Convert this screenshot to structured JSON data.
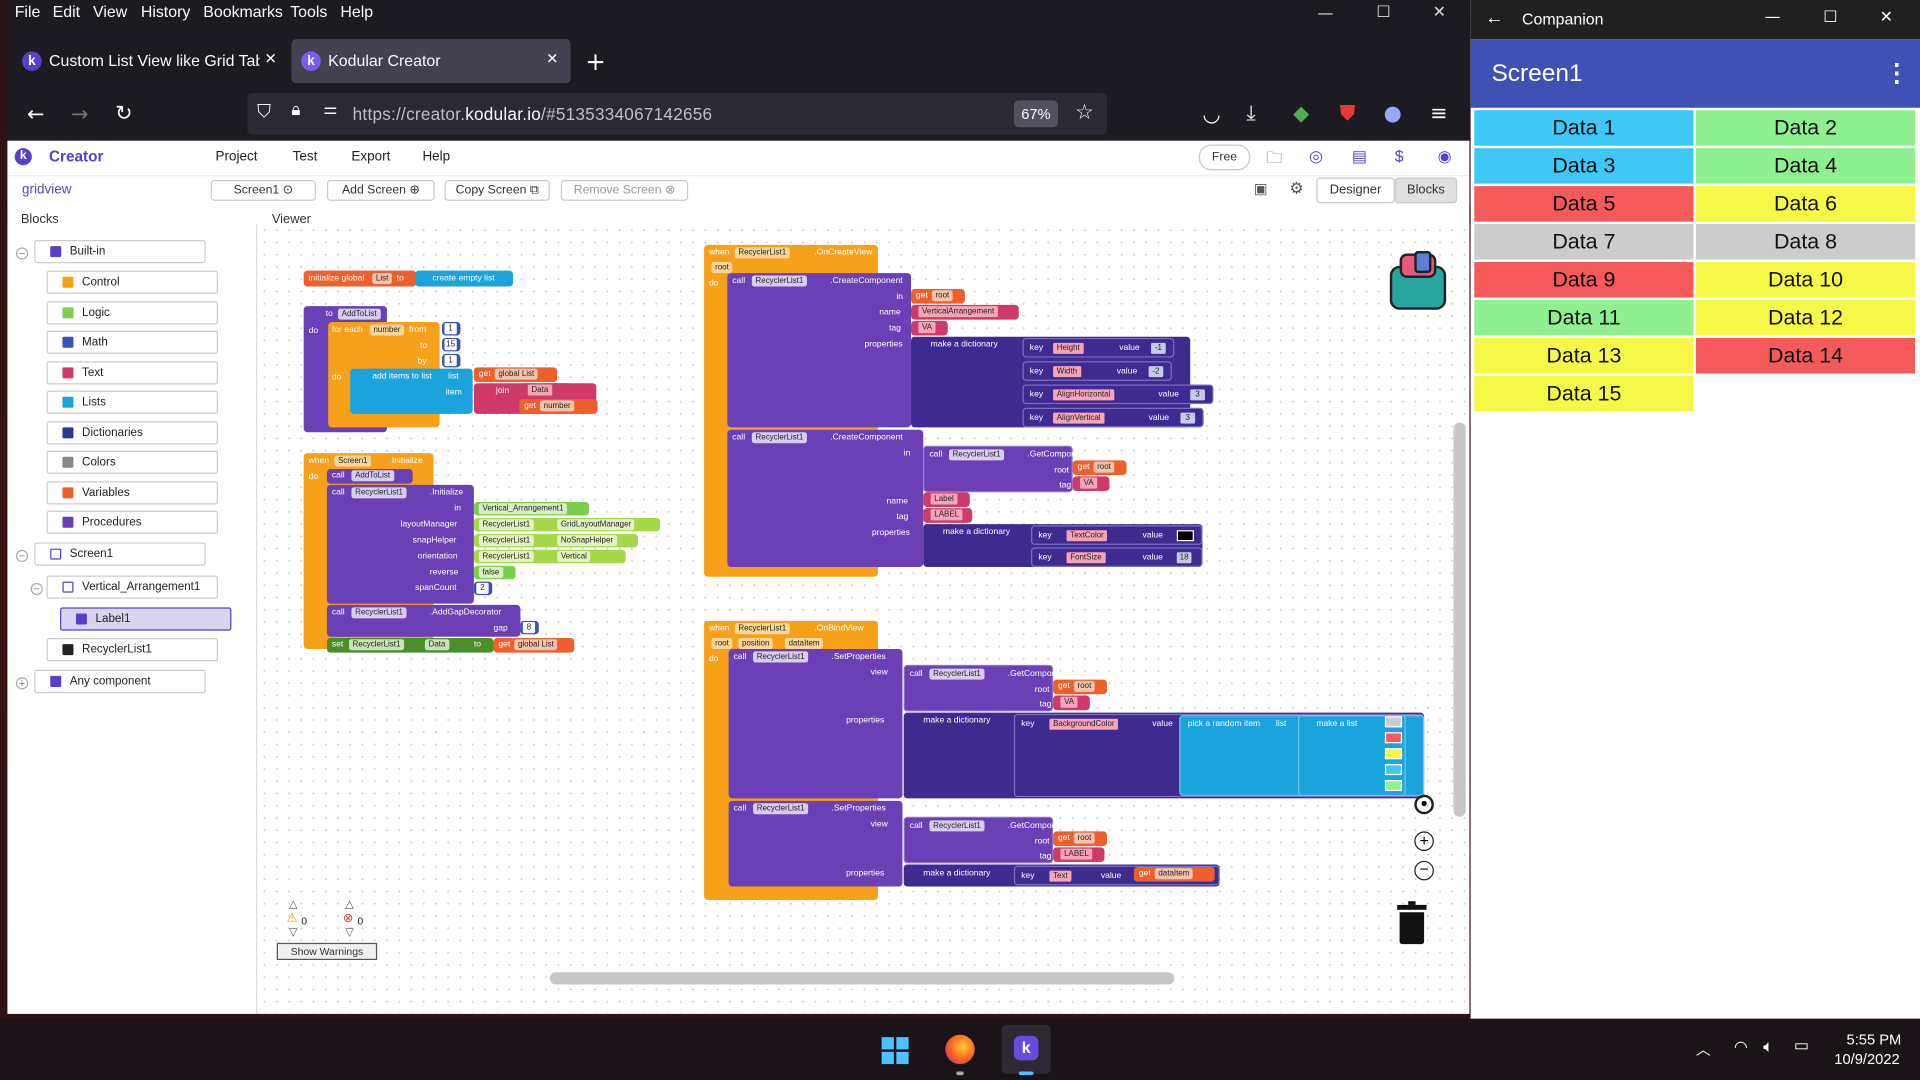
{
  "menubar": {
    "file": "File",
    "edit": "Edit",
    "view": "View",
    "history": "History",
    "bookmarks": "Bookmarks",
    "tools": "Tools",
    "help": "Help"
  },
  "tabs": [
    {
      "label": "Custom List View like Grid Table"
    },
    {
      "label": "Kodular Creator"
    }
  ],
  "url": {
    "prefix": "https://creator.",
    "domain": "kodular.io",
    "suffix": "/#5135334067142656",
    "zoom": "67%"
  },
  "kodular": {
    "brand": "Creator",
    "menu": [
      "Project",
      "Test",
      "Export",
      "Help"
    ],
    "plan": "Free",
    "project": "gridview",
    "screen_select": "Screen1",
    "add_screen": "Add Screen",
    "copy_screen": "Copy Screen",
    "remove_screen": "Remove Screen",
    "designer": "Designer",
    "blocks": "Blocks",
    "blocks_head": "Blocks",
    "viewer_head": "Viewer"
  },
  "tree": {
    "builtin": "Built-in",
    "items": [
      "Control",
      "Logic",
      "Math",
      "Text",
      "Lists",
      "Dictionaries",
      "Colors",
      "Variables",
      "Procedures"
    ],
    "screen": "Screen1",
    "va": "Vertical_Arrangement1",
    "label": "Label1",
    "recycler": "RecyclerList1",
    "any": "Any component"
  },
  "warnings": {
    "warn_count": "0",
    "err_count": "0",
    "show": "Show Warnings"
  },
  "companion": {
    "window_title": "Companion",
    "screen_title": "Screen1",
    "cells": [
      "Data 1",
      "Data 2",
      "Data 3",
      "Data 4",
      "Data 5",
      "Data 6",
      "Data 7",
      "Data 8",
      "Data 9",
      "Data 10",
      "Data 11",
      "Data 12",
      "Data 13",
      "Data 14",
      "Data 15"
    ],
    "colors": [
      "#3fc7f5",
      "#8ff08f",
      "#3fc7f5",
      "#8ff08f",
      "#f55a5a",
      "#f7f748",
      "#cccccc",
      "#cccccc",
      "#f55a5a",
      "#f7f748",
      "#8ff08f",
      "#f7f748",
      "#f7f748",
      "#f55a5a",
      "#f7f748"
    ]
  },
  "blocks": {
    "init": {
      "a": "initialize global",
      "b": "List",
      "c": "to",
      "d": "create empty list"
    },
    "proc": {
      "to": "to",
      "name": "AddToList",
      "do": "do",
      "foreach": "for each",
      "var": "number",
      "from": "from",
      "to2": "to",
      "by": "by",
      "v1": "1",
      "v2": "15",
      "v3": "1",
      "additems": "add items to list",
      "list": "list",
      "item": "item",
      "get": "get",
      "glist": "global List",
      "join": "join",
      "data": "Data",
      "getnum": "number"
    },
    "init2": {
      "when": "when",
      "screen": "Screen1",
      "ev": ".Initialize",
      "do": "do",
      "call": "call",
      "addtolist": "AddToList",
      "rl": "RecyclerList1",
      "init": ".Initialize",
      "in": "in",
      "va": "Vertical_Arrangement1",
      "lm": "layoutManager",
      "lmv": "GridLayoutManager",
      "sh": "snapHelper",
      "shv": "NoSnapHelper",
      "or": "orientation",
      "orv": "Vertical",
      "rev": "reverse",
      "revv": "false",
      "sc": "spanCount",
      "scv": "2",
      "gap": ".AddGapDecorator",
      "gapl": "gap",
      "gapv": "8",
      "set": "set",
      "dataprop": "Data",
      "to": "to"
    },
    "ocv": {
      "when": "when",
      "rl": "RecyclerList1",
      "ev": ".OnCreateView",
      "root": "root",
      "do": "do",
      "call": "call",
      "cc": ".CreateComponent",
      "in": "in",
      "get": "get",
      "name": "name",
      "tag": "tag",
      "props": "properties",
      "md": "make a dictionary",
      "key": "key",
      "value": "value",
      "varr": "VerticalArrangement",
      "va": "VA",
      "height": "Height",
      "width": "Width",
      "ah": "AlignHorizontal",
      "av": "AlignVertical",
      "hv": "-1",
      "wv": "-2",
      "ahv": "3",
      "avv": "3",
      "gc": ".GetComponent",
      "lname": "Label",
      "ltag": "LABEL",
      "tc": "TextColor",
      "fs": "FontSize",
      "fsv": "18"
    },
    "obv": {
      "when": "when",
      "rl": "RecyclerList1",
      "ev": ".OnBindView",
      "root": "root",
      "pos": "position",
      "di": "dataItem",
      "do": "do",
      "call": "call",
      "sp": ".SetProperties",
      "view": "view",
      "gc": ".GetComponent",
      "get": "get",
      "tag": "tag",
      "va": "VA",
      "props": "properties",
      "md": "make a dictionary",
      "key": "key",
      "value": "value",
      "bg": "BackgroundColor",
      "pick": "pick a random item",
      "list": "list",
      "ml": "make a list",
      "label": "LABEL",
      "text": "Text"
    }
  },
  "taskbar": {
    "time": "5:55 PM",
    "date": "10/9/2022"
  }
}
